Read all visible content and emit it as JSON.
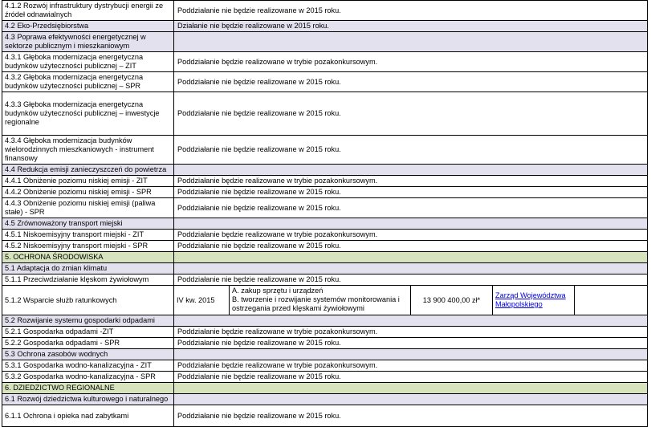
{
  "rows": [
    {
      "kind": "item",
      "label": "4.1.2 Rozwój infrastruktury dystrybucji energii ze źródeł odnawialnych",
      "note": "Poddziałanie nie będzie realizowane w 2015 roku."
    },
    {
      "kind": "section",
      "label": "4.2 Eko-Przedsiębiorstwa",
      "note": "Działanie nie będzie realizowane w 2015 roku."
    },
    {
      "kind": "section",
      "label": "4.3 Poprawa efektywności energetycznej w sektorze publicznym i mieszkaniowym",
      "note": ""
    },
    {
      "kind": "item",
      "label": "4.3.1 Głęboka modernizacja energetyczna budynków użyteczności publicznej – ZIT",
      "note": "Poddziałanie będzie realizowane w trybie pozakonkursowym."
    },
    {
      "kind": "item",
      "label": "4.3.2 Głęboka modernizacja energetyczna budynków użyteczności publicznej – SPR",
      "note": "Poddziałanie nie będzie realizowane w 2015 roku."
    },
    {
      "kind": "item",
      "label": "4.3.3 Głęboka modernizacja energetyczna budynków użyteczności publicznej – inwestycje regionalne",
      "note": "Poddziałanie nie będzie realizowane w 2015 roku."
    },
    {
      "kind": "item",
      "label": "4.3.4 Głęboka modernizacja budynków wielorodzinnych mieszkaniowych - instrument finansowy",
      "note": "Poddziałanie nie będzie realizowane w 2015 roku."
    },
    {
      "kind": "section",
      "label": "4.4 Redukcja emisji zanieczyszczeń do powietrza",
      "note": ""
    },
    {
      "kind": "item",
      "label": "4.4.1 Obniżenie poziomu niskiej emisji - ZIT",
      "note": "Poddziałanie będzie realizowane w trybie pozakonkursowym."
    },
    {
      "kind": "item",
      "label": "4.4.2 Obniżenie poziomu niskiej emisji - SPR",
      "note": "Poddziałanie nie będzie realizowane w 2015 roku."
    },
    {
      "kind": "item",
      "label": "4.4.3 Obniżenie poziomu niskiej emisji (paliwa stałe) - SPR",
      "note": "Poddziałanie nie będzie realizowane w 2015 roku."
    },
    {
      "kind": "section",
      "label": "4.5 Zrównoważony transport miejski",
      "note": ""
    },
    {
      "kind": "item",
      "label": "4.5.1 Niskoemisyjny transport miejski - ZIT",
      "note": "Poddziałanie będzie realizowane w trybie pozakonkursowym."
    },
    {
      "kind": "item",
      "label": "4.5.2 Niskoemisyjny transport miejski - SPR",
      "note": "Poddziałanie nie będzie realizowane w 2015 roku."
    },
    {
      "kind": "main",
      "label": "5. OCHRONA ŚRODOWISKA",
      "note": ""
    },
    {
      "kind": "section",
      "label": "5.1 Adaptacja do zmian klimatu",
      "note": ""
    },
    {
      "kind": "item",
      "label": "5.1.1 Przeciwdziałanie klęskom żywiołowym",
      "note": "Poddziałanie nie będzie realizowane w 2015 roku."
    },
    {
      "kind": "detail",
      "label": "5.1.2 Wsparcie służb ratunkowych",
      "quarter": "IV kw. 2015",
      "scope_a": "A. zakup sprzętu i urządzeń",
      "scope_b": "B. tworzenie i rozwijanie systemów monitorowania i ostrzegania przed klęskami żywiołowymi",
      "amount": "13 900 400,00 zł*",
      "institution": "Zarząd Województwa Małopolskiego"
    },
    {
      "kind": "section",
      "label": "5.2 Rozwijanie systemu gospodarki odpadami",
      "note": ""
    },
    {
      "kind": "item",
      "label": "5.2.1 Gospodarka odpadami -ZIT",
      "note": "Poddziałanie będzie realizowane w trybie pozakonkursowym."
    },
    {
      "kind": "item",
      "label": "5.2.2 Gospodarka odpadami - SPR",
      "note": "Poddziałanie nie będzie realizowane w 2015 roku."
    },
    {
      "kind": "section",
      "label": "5.3 Ochrona zasobów wodnych",
      "note": ""
    },
    {
      "kind": "item",
      "label": "5.3.1 Gospodarka wodno-kanalizacyjna - ZIT",
      "note": "Poddziałanie będzie realizowane w trybie pozakonkursowym."
    },
    {
      "kind": "item",
      "label": "5.3.2 Gospodarka wodno-kanalizacyjna - SPR",
      "note": "Poddziałanie nie będzie realizowane w 2015 roku."
    },
    {
      "kind": "main",
      "label": "6. DZIEDZICTWO REGIONALNE",
      "note": ""
    },
    {
      "kind": "section",
      "label": "6.1 Rozwój dziedzictwa kulturowego i naturalnego",
      "note": ""
    },
    {
      "kind": "item",
      "label": "6.1.1 Ochrona i opieka nad zabytkami",
      "note": "Poddziałanie nie będzie realizowane w 2015 roku."
    }
  ]
}
